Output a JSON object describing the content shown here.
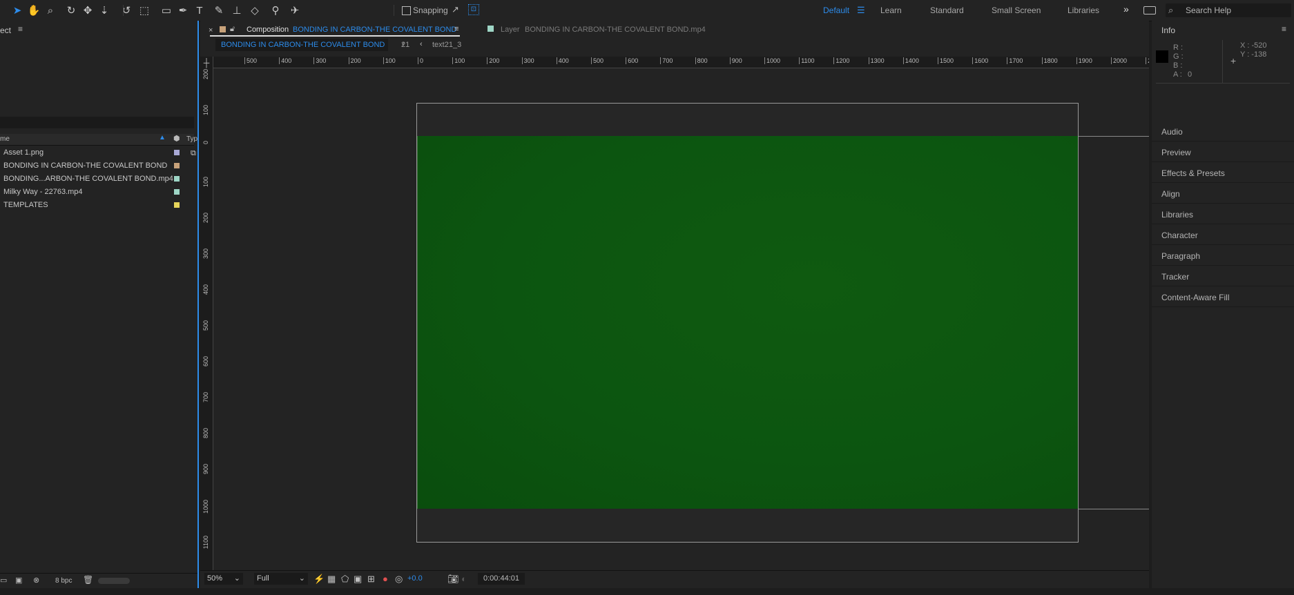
{
  "toolbar": {
    "tools": [
      {
        "name": "selection-tool-icon",
        "glyph": "➤",
        "active": true
      },
      {
        "name": "hand-tool-icon",
        "glyph": "✋"
      },
      {
        "name": "zoom-tool-icon",
        "glyph": "⌕"
      },
      {
        "name": "orbit-tool-icon",
        "glyph": "↻"
      },
      {
        "name": "pan-behind-tool-icon",
        "glyph": "✥"
      },
      {
        "name": "dolly-tool-icon",
        "glyph": "⇣"
      },
      {
        "name": "rotation-tool-icon",
        "glyph": "↺"
      },
      {
        "name": "anchor-tool-icon",
        "glyph": "⬚"
      },
      {
        "name": "rectangle-tool-icon",
        "glyph": "▭"
      },
      {
        "name": "pen-tool-icon",
        "glyph": "✒"
      },
      {
        "name": "type-tool-icon",
        "glyph": "T"
      },
      {
        "name": "brush-tool-icon",
        "glyph": "✎"
      },
      {
        "name": "clone-stamp-tool-icon",
        "glyph": "⊥"
      },
      {
        "name": "eraser-tool-icon",
        "glyph": "◇"
      },
      {
        "name": "roto-brush-tool-icon",
        "glyph": "⚲"
      },
      {
        "name": "puppet-pin-tool-icon",
        "glyph": "✈"
      }
    ],
    "snapping_label": "Snapping",
    "workspaces": [
      "Default",
      "Learn",
      "Standard",
      "Small Screen",
      "Libraries"
    ],
    "active_workspace": "Default",
    "search_placeholder": "Search Help"
  },
  "project": {
    "title": "ect",
    "columns": {
      "name": "me",
      "type": "Typ"
    },
    "items": [
      {
        "label": "Asset 1.png",
        "color": "#a9a9d6"
      },
      {
        "label": "BONDING IN CARBON-THE COVALENT BOND",
        "color": "#c8a27a"
      },
      {
        "label": "BONDING...ARBON-THE COVALENT BOND.mp4",
        "color": "#9ed6c6"
      },
      {
        "label": "Milky Way - 22763.mp4",
        "color": "#9ed6c6"
      },
      {
        "label": "TEMPLATES",
        "color": "#e6d45a"
      }
    ],
    "bpc_label": "8 bpc"
  },
  "composition": {
    "tab_prefix": "Composition",
    "tab_name": "BONDING IN CARBON-THE COVALENT BOND",
    "layer_prefix": "Layer",
    "layer_name": "BONDING IN CARBON-THE COVALENT BOND.mp4",
    "breadcrumb_comp": "BONDING IN CARBON-THE COVALENT BOND",
    "breadcrumb_num": "21",
    "breadcrumb_layer": "text21_3",
    "ruler_top": [
      "500",
      "400",
      "300",
      "200",
      "100",
      "0",
      "100",
      "200",
      "300",
      "400",
      "500",
      "600",
      "700",
      "800",
      "900",
      "1000",
      "1100",
      "1200",
      "1300",
      "1400",
      "1500",
      "1600",
      "1700",
      "1800",
      "1900",
      "2000",
      "2"
    ],
    "ruler_left": [
      "200",
      "100",
      "0",
      "100",
      "200",
      "300",
      "400",
      "500",
      "600",
      "700",
      "800",
      "900",
      "1000",
      "1100"
    ],
    "zoom": "50%",
    "resolution": "Full",
    "exposure": "+0.0",
    "timecode": "0:00:44:01"
  },
  "panels": {
    "info": {
      "title": "Info",
      "r_label": "R :",
      "g_label": "G :",
      "b_label": "B :",
      "a_label": "A :",
      "a_value": "0",
      "x_label": "X : -520",
      "y_label": "Y : -138"
    },
    "items": [
      "Audio",
      "Preview",
      "Effects & Presets",
      "Align",
      "Libraries",
      "Character",
      "Paragraph",
      "Tracker",
      "Content-Aware Fill"
    ]
  }
}
